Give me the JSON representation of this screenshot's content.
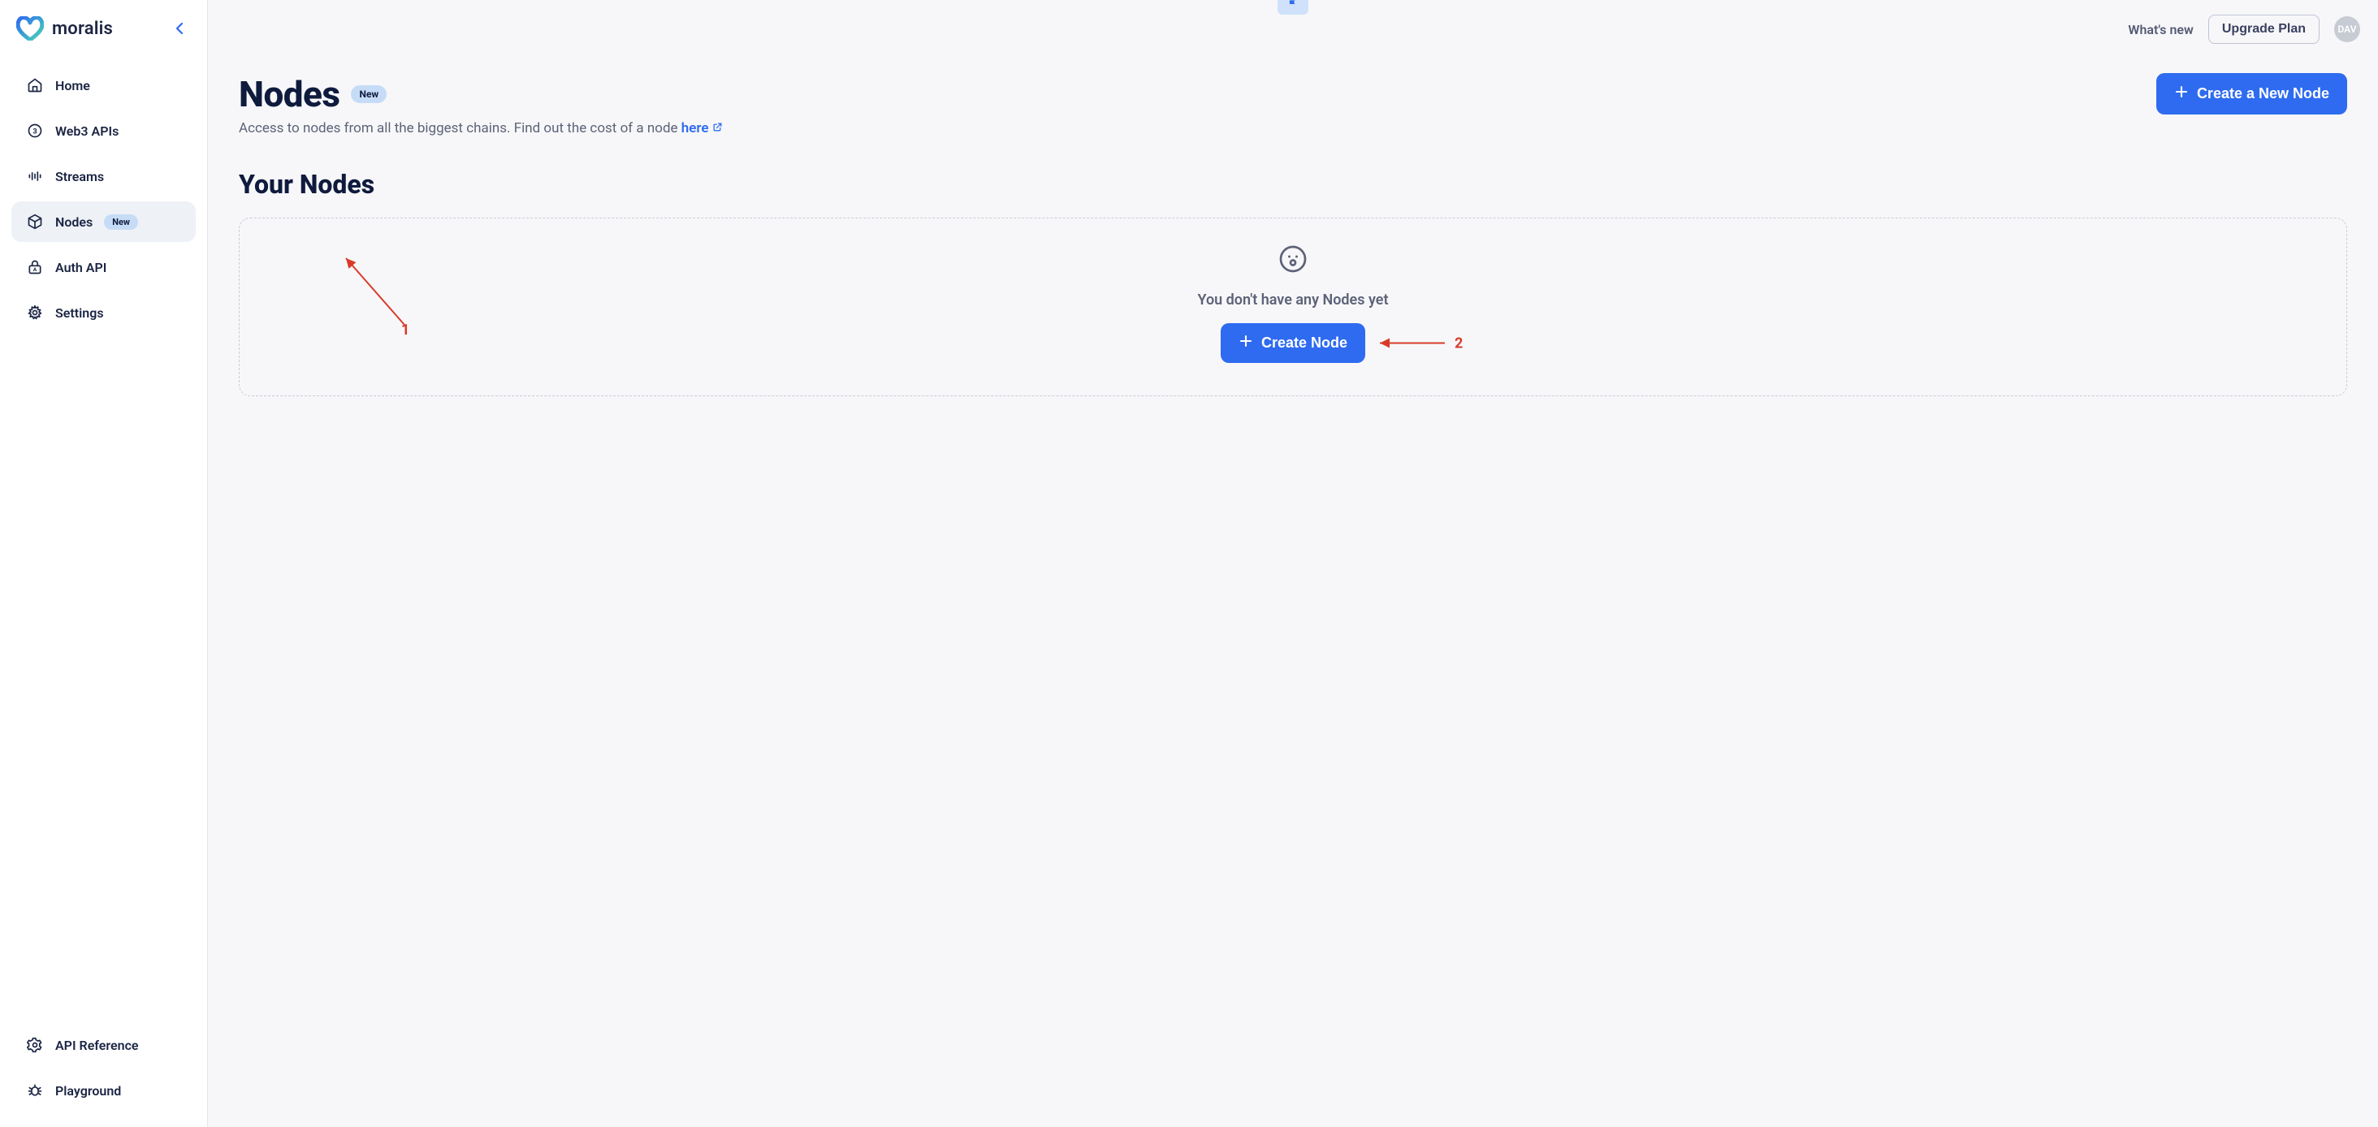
{
  "brand": {
    "name": "moralis"
  },
  "sidebar": {
    "items": [
      {
        "label": "Home"
      },
      {
        "label": "Web3 APIs"
      },
      {
        "label": "Streams"
      },
      {
        "label": "Nodes",
        "badge": "New"
      },
      {
        "label": "Auth API"
      },
      {
        "label": "Settings"
      }
    ],
    "bottom": [
      {
        "label": "API Reference"
      },
      {
        "label": "Playground"
      }
    ]
  },
  "topbar": {
    "whats_new": "What's new",
    "upgrade": "Upgrade Plan",
    "avatar_initials": "DAV"
  },
  "page": {
    "title": "Nodes",
    "title_badge": "New",
    "subtitle_prefix": "Access to nodes from all the biggest chains. Find out the cost of a node ",
    "subtitle_link": "here",
    "create_new_node": "Create a New Node",
    "section_title": "Your Nodes",
    "empty_text": "You don't have any Nodes yet",
    "create_node": "Create Node"
  },
  "annotations": {
    "one": "1",
    "two": "2"
  },
  "colors": {
    "primary": "#2e6bf0",
    "badge_bg": "#c6dcf6",
    "annotation": "#d83b2a"
  }
}
